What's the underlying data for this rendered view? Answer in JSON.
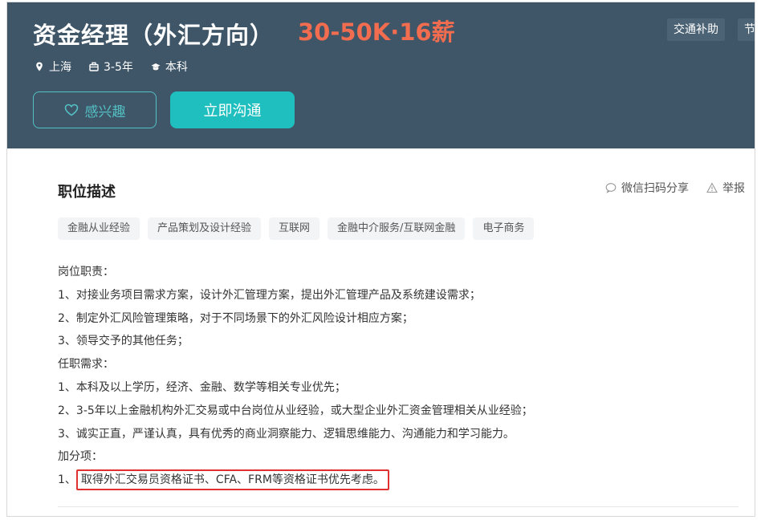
{
  "header": {
    "title": "资金经理（外汇方向）",
    "salary": "30-50K·16薪",
    "salary_color": "#f26d4f",
    "perks": [
      "交通补助",
      "节"
    ],
    "meta": [
      {
        "icon": "location-pin-icon",
        "text": "上海"
      },
      {
        "icon": "briefcase-icon",
        "text": "3-5年"
      },
      {
        "icon": "graduation-cap-icon",
        "text": "本科"
      }
    ],
    "interest_button": "感兴趣",
    "chat_button": "立即沟通"
  },
  "description": {
    "title": "职位描述",
    "share_label": "微信扫码分享",
    "report_label": "举报",
    "tags": [
      "金融从业经验",
      "产品策划及设计经验",
      "互联网",
      "金融中介服务/互联网金融",
      "电子商务"
    ],
    "lines": [
      "岗位职责：",
      "1、对接业务项目需求方案，设计外汇管理方案，提出外汇管理产品及系统建设需求；",
      "2、制定外汇风险管理策略，对于不同场景下的外汇风险设计相应方案；",
      "3、领导交予的其他任务；",
      "任职需求：",
      "1、本科及以上学历，经济、金融、数学等相关专业优先；",
      "2、3-5年以上金融机构外汇交易或中台岗位从业经验，或大型企业外汇资金管理相关从业经验；",
      "3、诚实正直，严谨认真，具有优秀的商业洞察能力、逻辑思维能力、沟通能力和学习能力。",
      "加分项："
    ],
    "last_line_prefix": "1、",
    "last_line_highlight": "取得外汇交易员资格证书、CFA、FRM等资格证书优先考虑。",
    "highlight_color": "#e03030"
  }
}
